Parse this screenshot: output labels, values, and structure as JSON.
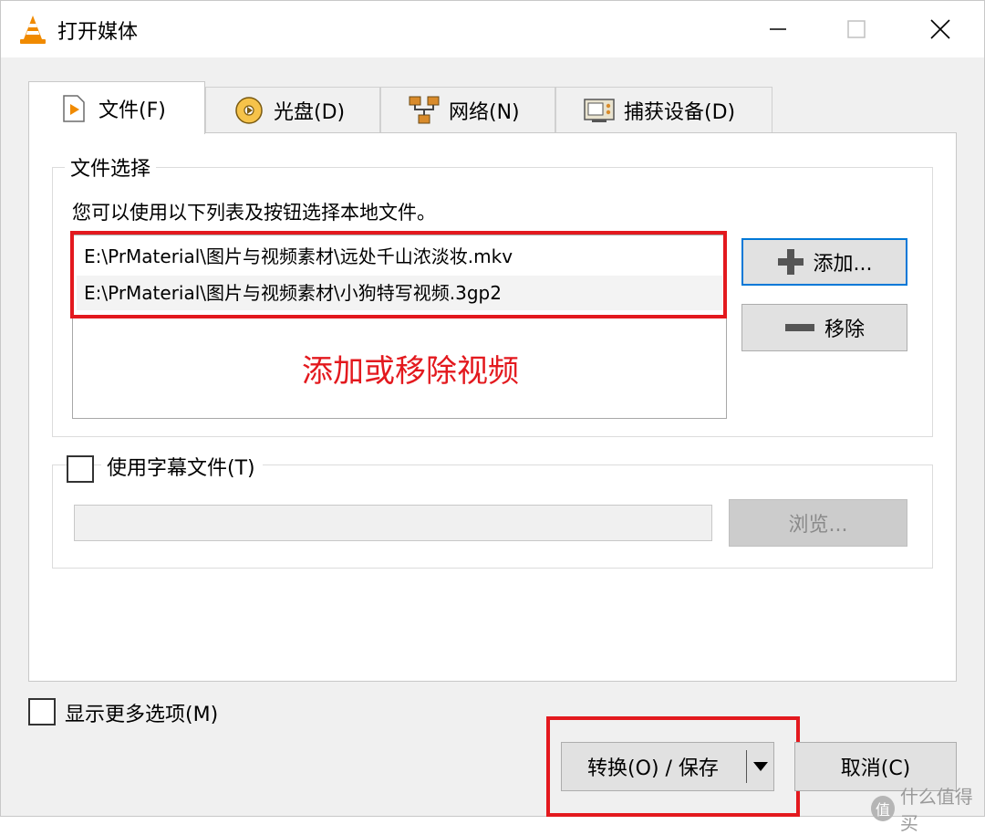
{
  "window": {
    "title": "打开媒体",
    "icons": {
      "app": "vlc-cone-icon",
      "minimize": "minimize-icon",
      "maximize": "maximize-icon",
      "close": "close-icon"
    }
  },
  "tabs": [
    {
      "label": "文件(F)",
      "icon": "file-play-icon",
      "active": true
    },
    {
      "label": "光盘(D)",
      "icon": "disc-icon",
      "active": false
    },
    {
      "label": "网络(N)",
      "icon": "network-icon",
      "active": false
    },
    {
      "label": "捕获设备(D)",
      "icon": "capture-device-icon",
      "active": false
    }
  ],
  "file_selection": {
    "group_title": "文件选择",
    "hint": "您可以使用以下列表及按钮选择本地文件。",
    "files": [
      "E:\\PrMaterial\\图片与视频素材\\远处千山浓淡妆.mkv",
      "E:\\PrMaterial\\图片与视频素材\\小狗特写视频.3gp2"
    ],
    "add_label": "添加...",
    "remove_label": "移除",
    "annotation": "添加或移除视频"
  },
  "subtitle": {
    "label": "使用字幕文件(T)",
    "checked": false,
    "path_value": "",
    "browse_label": "浏览..."
  },
  "more_options": {
    "label": "显示更多选项(M)",
    "checked": false
  },
  "actions": {
    "convert_label": "转换(O) / 保存",
    "cancel_label": "取消(C)"
  },
  "watermark": {
    "icon_glyph": "值",
    "text": "什么值得买"
  },
  "colors": {
    "annotation_red": "#e3191e",
    "focus_blue": "#0078d7",
    "window_bg": "#f0f0f0"
  }
}
